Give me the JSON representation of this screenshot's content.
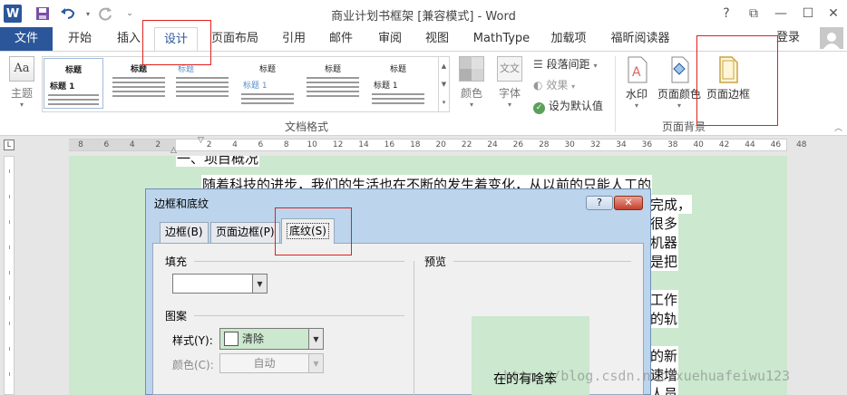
{
  "window": {
    "title": "商业计划书框架 [兼容模式] - Word",
    "word_icon": "W",
    "controls": {
      "help": "?",
      "restore_ribbon": "⧉",
      "minimize": "—",
      "maximize": "☐",
      "close": "✕"
    }
  },
  "tabs": [
    "文件",
    "开始",
    "插入",
    "设计",
    "页面布局",
    "引用",
    "邮件",
    "审阅",
    "视图",
    "MathType",
    "加载项",
    "福昕阅读器"
  ],
  "active_tab": "设计",
  "account": {
    "login_label": "登录"
  },
  "ribbon": {
    "theme": {
      "label": "主题",
      "icon_text": "Aa"
    },
    "styles": [
      {
        "heading": "标题",
        "sub": "标题 1"
      },
      {
        "heading": "标题",
        "sub": ""
      },
      {
        "heading": "标题",
        "sub": ""
      },
      {
        "heading": "标题",
        "sub": "标题 1"
      },
      {
        "heading": "标题",
        "sub": ""
      },
      {
        "heading": "标题",
        "sub": "标题 1"
      },
      {
        "heading": "标题",
        "sub": "标题 1"
      }
    ],
    "colors_label": "颜色",
    "fonts_label": "字体",
    "fonts_icon_text": "文文",
    "paragraph_spacing": "段落间距",
    "effects": "效果",
    "set_default": "设为默认值",
    "doc_format_group": "文档格式",
    "watermark": "水印",
    "page_color": "页面颜色",
    "page_borders": "页面边框",
    "page_background_group": "页面背景"
  },
  "ruler": {
    "ticks": [
      "8",
      "6",
      "4",
      "2",
      "2",
      "4",
      "6",
      "8",
      "10",
      "12",
      "14",
      "16",
      "18",
      "20",
      "22",
      "24",
      "26",
      "28",
      "30",
      "32",
      "34",
      "36",
      "38",
      "40",
      "42",
      "44",
      "46",
      "48"
    ]
  },
  "document": {
    "heading_fragment": "一、项目概况",
    "lines": [
      "随着科技的进步，我们的生活也在不断的发生着变化，从以前的只能人工的",
      "完成，",
      "很多",
      "机器",
      "是把",
      "工作",
      "的轨",
      "的新",
      "速增",
      "人员"
    ]
  },
  "dialog": {
    "title": "边框和底纹",
    "help": "?",
    "close": "✕",
    "tabs": [
      "边框(B)",
      "页面边框(P)",
      "底纹(S)"
    ],
    "active_tab": "底纹(S)",
    "fill_label": "填充",
    "fill_value": "",
    "pattern_label": "图案",
    "style_label": "样式(Y):",
    "style_value": "清除",
    "color_label": "颜色(C):",
    "color_value": "自动",
    "preview_label": "预览",
    "preview_text": "在的有啥笨"
  },
  "watermark_text": "http://blog.csdn.net/xuehuafeiwu123",
  "colors": {
    "accent": "#2b579a",
    "page_bg": "#cce8cf",
    "highlight": "#e02020"
  }
}
